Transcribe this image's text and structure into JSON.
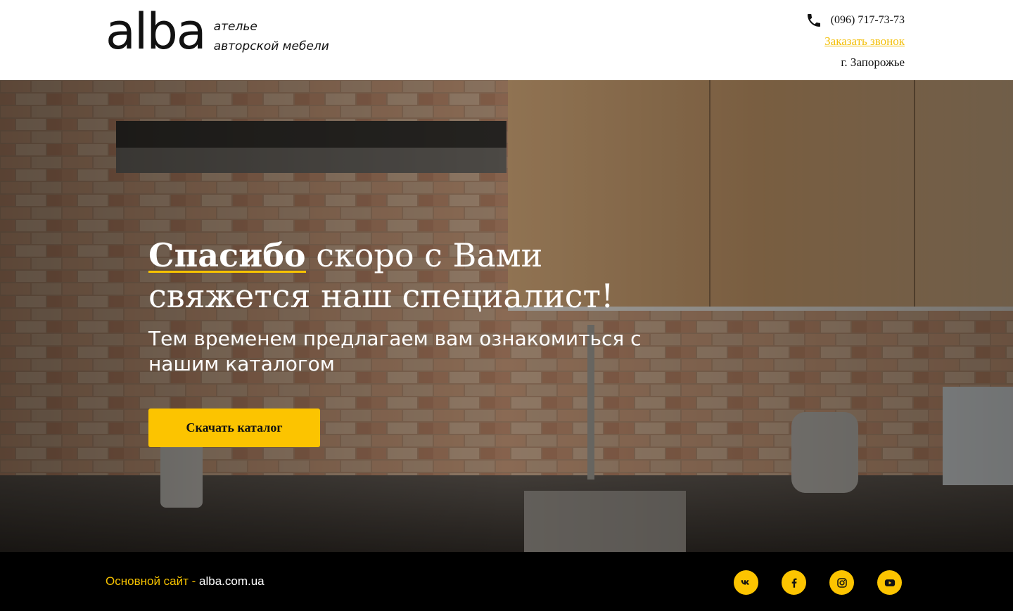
{
  "header": {
    "logo_word": "alba",
    "logo_tagline_line1": "ателье",
    "logo_tagline_line2": "авторской мебели",
    "phone": "(096) 717-73-73",
    "callback_link": "Заказать звонок",
    "city": "г. Запорожье"
  },
  "hero": {
    "title_strong": "Спасибо",
    "title_rest_line1": " скоро с Вами",
    "title_line2": "свяжется наш специалист!",
    "subtitle": "Тем временем предлагаем вам ознакомиться с нашим каталогом",
    "cta_label": "Скачать каталог"
  },
  "footer": {
    "label": "Основной сайт -",
    "site": " alba.com.ua",
    "socials": [
      "vk-icon",
      "facebook-icon",
      "instagram-icon",
      "youtube-icon"
    ]
  },
  "colors": {
    "accent": "#fcc400",
    "footer_bg": "#000000",
    "text_dark": "#111111"
  }
}
